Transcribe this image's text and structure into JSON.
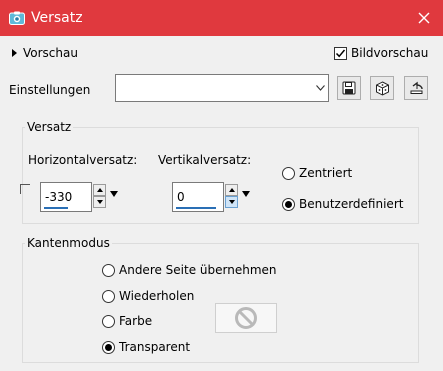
{
  "window": {
    "title": "Versatz",
    "accent": "#e0393e"
  },
  "preview": {
    "toggle_label": "Vorschau",
    "image_preview_label": "Bildvorschau",
    "image_preview_checked": true
  },
  "settings": {
    "label": "Einstellungen",
    "value": ""
  },
  "offset_group": {
    "label": "Versatz",
    "horizontal_label": "Horizontalversatz:",
    "horizontal_value": "-330",
    "vertical_label": "Vertikalversatz:",
    "vertical_value": "0",
    "centered_label": "Zentriert",
    "custom_label": "Benutzerdefiniert",
    "selected": "custom"
  },
  "edge_group": {
    "label": "Kantenmodus",
    "options": [
      "Andere Seite übernehmen",
      "Wiederholen",
      "Farbe",
      "Transparent"
    ],
    "selected": "Transparent"
  },
  "icons": {
    "title": "camera-icon",
    "close": "close-icon",
    "save": "save-icon",
    "dice": "dice-icon",
    "reset": "reset-icon",
    "no_color": "prohibited-icon"
  }
}
